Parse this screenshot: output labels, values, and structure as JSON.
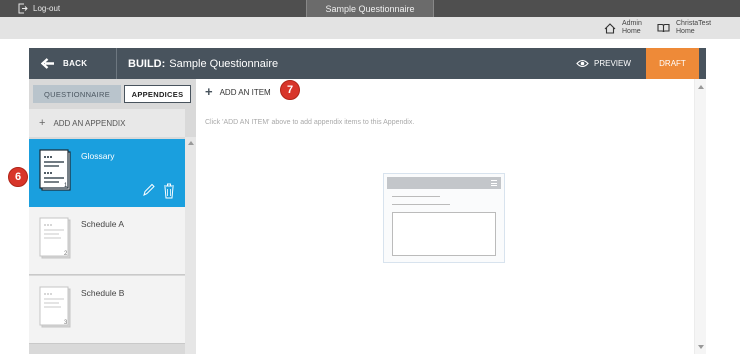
{
  "topbar": {
    "logout_label": "Log-out",
    "active_tab": "Sample Questionnaire"
  },
  "homebar": {
    "admin_home": [
      "Admin",
      "Home"
    ],
    "christa_home": [
      "ChristaTest",
      "Home"
    ]
  },
  "builder": {
    "back_label": "BACK",
    "build_prefix": "BUILD:",
    "build_title": "Sample Questionnaire",
    "preview_label": "PREVIEW",
    "status_label": "DRAFT"
  },
  "tabs": {
    "questionnaire": "QUESTIONNAIRE",
    "appendices": "APPENDICES"
  },
  "left": {
    "add_appendix": "ADD AN APPENDIX",
    "items": [
      {
        "title": "Glossary",
        "page": "1",
        "state": "selected"
      },
      {
        "title": "Schedule A",
        "page": "2",
        "state": "normal"
      },
      {
        "title": "Schedule B",
        "page": "3",
        "state": "normal"
      }
    ]
  },
  "right": {
    "add_item": "ADD AN ITEM",
    "hint": "Click 'ADD AN ITEM' above to add appendix items to this Appendix."
  },
  "callouts": {
    "left": "6",
    "right": "7"
  },
  "colors": {
    "header": "#48535d",
    "accent_orange": "#ee8a38",
    "selected_blue": "#1a9fde",
    "callout_red": "#d8352a"
  },
  "icons": {
    "logout": "logout-icon",
    "home": "home-icon",
    "book": "book-icon",
    "back": "arrow-left-icon",
    "preview": "eye-icon",
    "edit": "pencil-icon",
    "delete": "trash-icon",
    "add": "plus-icon"
  }
}
